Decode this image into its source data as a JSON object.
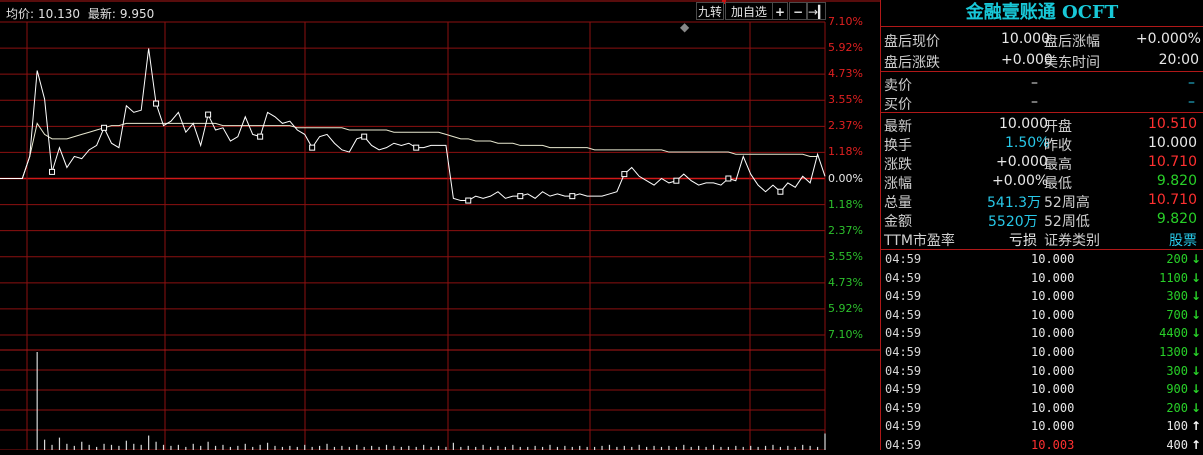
{
  "header": {
    "avg_label": "均价:",
    "avg_value": "10.130",
    "last_label": "最新:",
    "last_value": "9.950"
  },
  "toolbar": {
    "jiuzhuan": "九转",
    "add_self": "加自选",
    "plus": "+",
    "minus": "−",
    "arrow": "→▎"
  },
  "axis": {
    "labels": [
      "7.10%",
      "5.92%",
      "4.73%",
      "3.55%",
      "2.37%",
      "1.18%",
      "0.00%",
      "1.18%",
      "2.37%",
      "3.55%",
      "4.73%",
      "5.92%",
      "7.10%"
    ]
  },
  "chart_data": {
    "type": "line",
    "y_unit": "percent change",
    "ylim": [
      -7.1,
      7.1
    ],
    "series": [
      {
        "values": [
          0,
          0,
          0,
          0,
          1.0,
          4.9,
          3.6,
          0.3,
          1.4,
          0.5,
          1.0,
          0.9,
          1.3,
          1.5,
          2.3,
          1.6,
          1.4,
          3.3,
          3.0,
          3.1,
          5.9,
          3.4,
          2.4,
          2.6,
          3.0,
          2.1,
          2.5,
          1.5,
          2.9,
          2.2,
          2.3,
          1.7,
          1.9,
          2.8,
          2.0,
          1.9,
          3.0,
          2.8,
          2.5,
          2.6,
          2.2,
          2.0,
          1.4,
          1.9,
          2.0,
          1.6,
          1.3,
          1.2,
          1.8,
          1.9,
          1.5,
          1.3,
          1.4,
          1.6,
          1.5,
          1.6,
          1.4,
          1.4,
          1.5,
          1.5,
          1.5,
          -0.9,
          -1.0,
          -1.0,
          -0.8,
          -0.9,
          -0.8,
          -0.6,
          -0.9,
          -0.8,
          -0.8,
          -0.7,
          -0.9,
          -0.6,
          -0.8,
          -0.7,
          -0.8,
          -0.8,
          -0.7,
          -0.8,
          -0.8,
          -0.8,
          -0.7,
          -0.6,
          0.2,
          0.5,
          0.1,
          -0.1,
          -0.3,
          0.0,
          -0.2,
          -0.1,
          0.2,
          -0.1,
          -0.3,
          -0.2,
          -0.2,
          -0.3,
          0.0,
          -0.1,
          1.0,
          0.2,
          -0.3,
          -0.6,
          -0.3,
          -0.6,
          -0.2,
          -0.4,
          0.1,
          -0.2,
          1.1,
          0.1
        ]
      },
      {
        "values": [
          0,
          0,
          0,
          0,
          1.0,
          2.5,
          2.0,
          1.8,
          1.8,
          1.8,
          1.9,
          2.0,
          2.1,
          2.2,
          2.3,
          2.4,
          2.4,
          2.5,
          2.5,
          2.5,
          2.5,
          2.5,
          2.5,
          2.5,
          2.5,
          2.5,
          2.5,
          2.5,
          2.5,
          2.5,
          2.4,
          2.4,
          2.4,
          2.4,
          2.4,
          2.4,
          2.4,
          2.4,
          2.4,
          2.4,
          2.3,
          2.3,
          2.3,
          2.3,
          2.3,
          2.3,
          2.3,
          2.2,
          2.2,
          2.2,
          2.2,
          2.2,
          2.2,
          2.1,
          2.1,
          2.1,
          2.1,
          2.1,
          2.1,
          2.1,
          2.0,
          1.9,
          1.8,
          1.8,
          1.7,
          1.7,
          1.7,
          1.6,
          1.6,
          1.6,
          1.5,
          1.5,
          1.5,
          1.5,
          1.4,
          1.4,
          1.4,
          1.4,
          1.4,
          1.4,
          1.3,
          1.3,
          1.3,
          1.3,
          1.3,
          1.3,
          1.3,
          1.3,
          1.3,
          1.3,
          1.2,
          1.2,
          1.2,
          1.2,
          1.2,
          1.2,
          1.2,
          1.2,
          1.2,
          1.1,
          1.1,
          1.1,
          1.1,
          1.1,
          1.1,
          1.1,
          1.1,
          1.1,
          1.1,
          1.0,
          1.0
        ]
      }
    ],
    "volume": [
      0,
      0,
      0,
      0,
      0,
      95,
      10,
      5,
      12,
      6,
      4,
      8,
      5,
      3,
      6,
      5,
      4,
      9,
      6,
      5,
      14,
      8,
      5,
      4,
      5,
      3,
      6,
      4,
      8,
      4,
      5,
      3,
      4,
      6,
      3,
      5,
      7,
      4,
      3,
      4,
      3,
      5,
      3,
      4,
      6,
      3,
      4,
      3,
      5,
      3,
      4,
      3,
      5,
      4,
      3,
      4,
      3,
      5,
      3,
      4,
      3,
      7,
      3,
      4,
      3,
      5,
      3,
      4,
      3,
      5,
      3,
      3,
      4,
      3,
      5,
      3,
      4,
      3,
      4,
      3,
      3,
      4,
      5,
      3,
      4,
      3,
      5,
      3,
      4,
      3,
      4,
      3,
      5,
      3,
      4,
      3,
      5,
      3,
      3,
      4,
      3,
      4,
      3,
      4,
      5,
      3,
      4,
      3,
      5,
      4,
      3,
      16
    ]
  },
  "panel": {
    "title": "金融壹账通 OCFT",
    "after_price_label": "盘后现价",
    "after_price": "10.000",
    "after_pct_label": "盘后涨幅",
    "after_pct": "+0.000%",
    "after_chg_label": "盘后涨跌",
    "after_chg": "+0.000",
    "us_time_label": "美东时间",
    "us_time": "20:00",
    "ask_label": "卖价",
    "ask_value": "–",
    "ask_vol": "–",
    "bid_label": "买价",
    "bid_value": "–",
    "bid_vol": "–",
    "last_label": "最新",
    "last": "10.000",
    "open_label": "开盘",
    "open": "10.510",
    "turnover_label": "换手",
    "turnover": "1.50%",
    "prev_close_label": "昨收",
    "prev_close": "10.000",
    "change_label": "涨跌",
    "change": "+0.000",
    "high_label": "最高",
    "high": "10.710",
    "pct_label": "涨幅",
    "pct": "+0.00%",
    "low_label": "最低",
    "low": "9.820",
    "volume_label": "总量",
    "volume": "541.3万",
    "high52_label": "52周高",
    "high52": "10.710",
    "amount_label": "金额",
    "amount": "5520万",
    "low52_label": "52周低",
    "low52": "9.820",
    "pe_label": "TTM市盈率",
    "pe": "亏损",
    "type_label": "证券类别",
    "type": "股票"
  },
  "ticks": [
    {
      "time": "04:59",
      "price": "10.000",
      "vol": "200",
      "dir": "down"
    },
    {
      "time": "04:59",
      "price": "10.000",
      "vol": "1100",
      "dir": "down"
    },
    {
      "time": "04:59",
      "price": "10.000",
      "vol": "300",
      "dir": "down"
    },
    {
      "time": "04:59",
      "price": "10.000",
      "vol": "700",
      "dir": "down"
    },
    {
      "time": "04:59",
      "price": "10.000",
      "vol": "4400",
      "dir": "down"
    },
    {
      "time": "04:59",
      "price": "10.000",
      "vol": "1300",
      "dir": "down"
    },
    {
      "time": "04:59",
      "price": "10.000",
      "vol": "300",
      "dir": "down"
    },
    {
      "time": "04:59",
      "price": "10.000",
      "vol": "900",
      "dir": "down"
    },
    {
      "time": "04:59",
      "price": "10.000",
      "vol": "200",
      "dir": "down"
    },
    {
      "time": "04:59",
      "price": "10.000",
      "vol": "100",
      "dir": "up"
    },
    {
      "time": "04:59",
      "price": "10.003",
      "vol": "400",
      "dir": "up"
    }
  ],
  "colors": {
    "up": "#ff3030",
    "down": "#28d028",
    "grid_red": "#8b1010",
    "price_line": "#ffffff",
    "avg_line": "#e8e8d0"
  }
}
